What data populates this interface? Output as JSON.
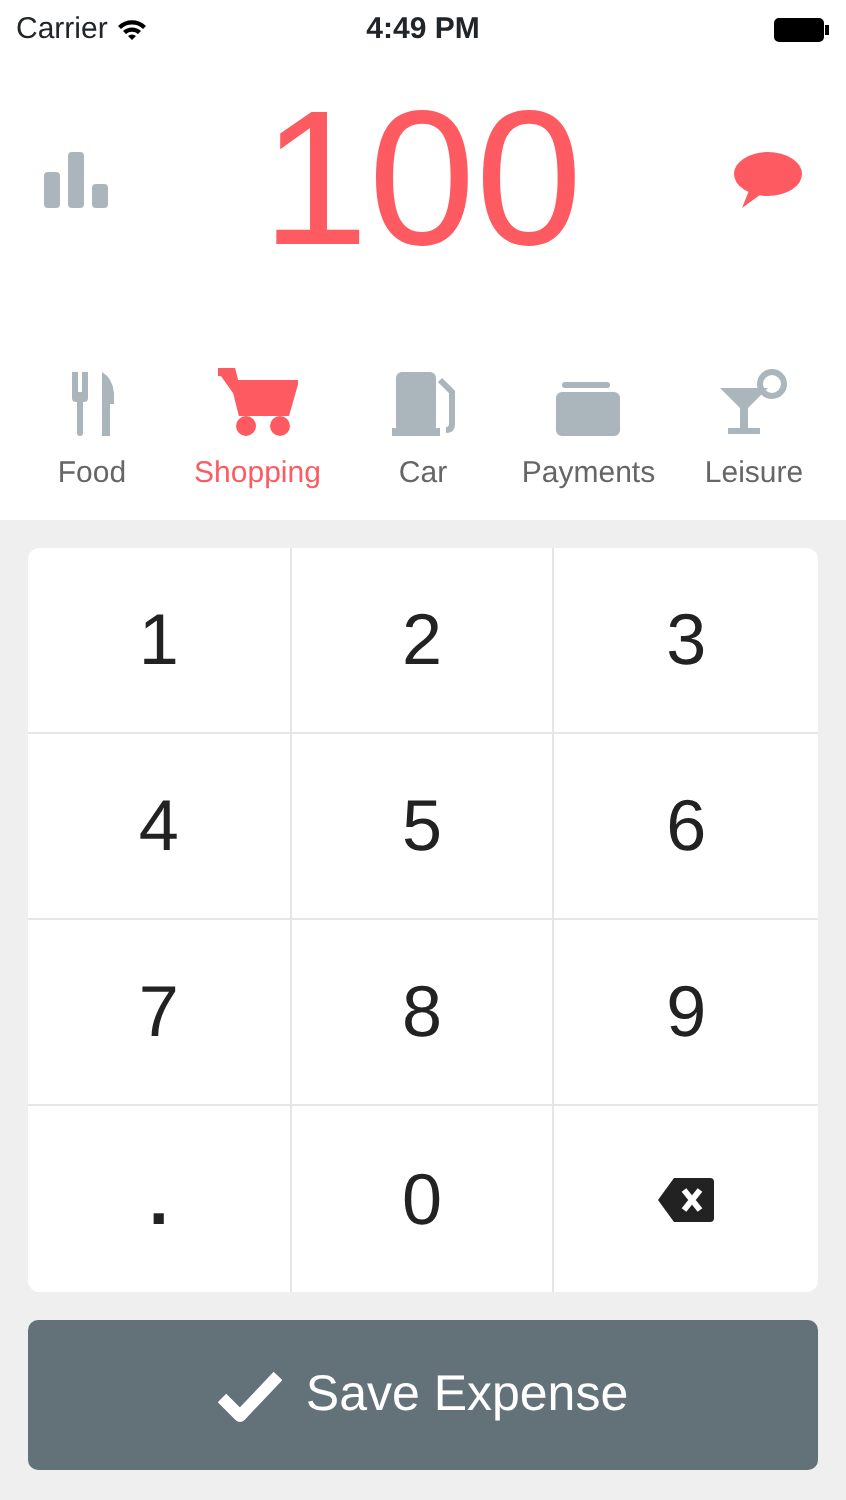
{
  "status_bar": {
    "carrier": "Carrier",
    "time": "4:49 PM"
  },
  "amount": "100",
  "categories": [
    {
      "label": "Food",
      "selected": false
    },
    {
      "label": "Shopping",
      "selected": true
    },
    {
      "label": "Car",
      "selected": false
    },
    {
      "label": "Payments",
      "selected": false
    },
    {
      "label": "Leisure",
      "selected": false
    }
  ],
  "keypad": [
    {
      "kind": "digit",
      "label": "1"
    },
    {
      "kind": "digit",
      "label": "2"
    },
    {
      "kind": "digit",
      "label": "3"
    },
    {
      "kind": "digit",
      "label": "4"
    },
    {
      "kind": "digit",
      "label": "5"
    },
    {
      "kind": "digit",
      "label": "6"
    },
    {
      "kind": "digit",
      "label": "7"
    },
    {
      "kind": "digit",
      "label": "8"
    },
    {
      "kind": "digit",
      "label": "9"
    },
    {
      "kind": "dot",
      "label": "."
    },
    {
      "kind": "digit",
      "label": "0"
    },
    {
      "kind": "backspace"
    }
  ],
  "save_button": "Save Expense"
}
